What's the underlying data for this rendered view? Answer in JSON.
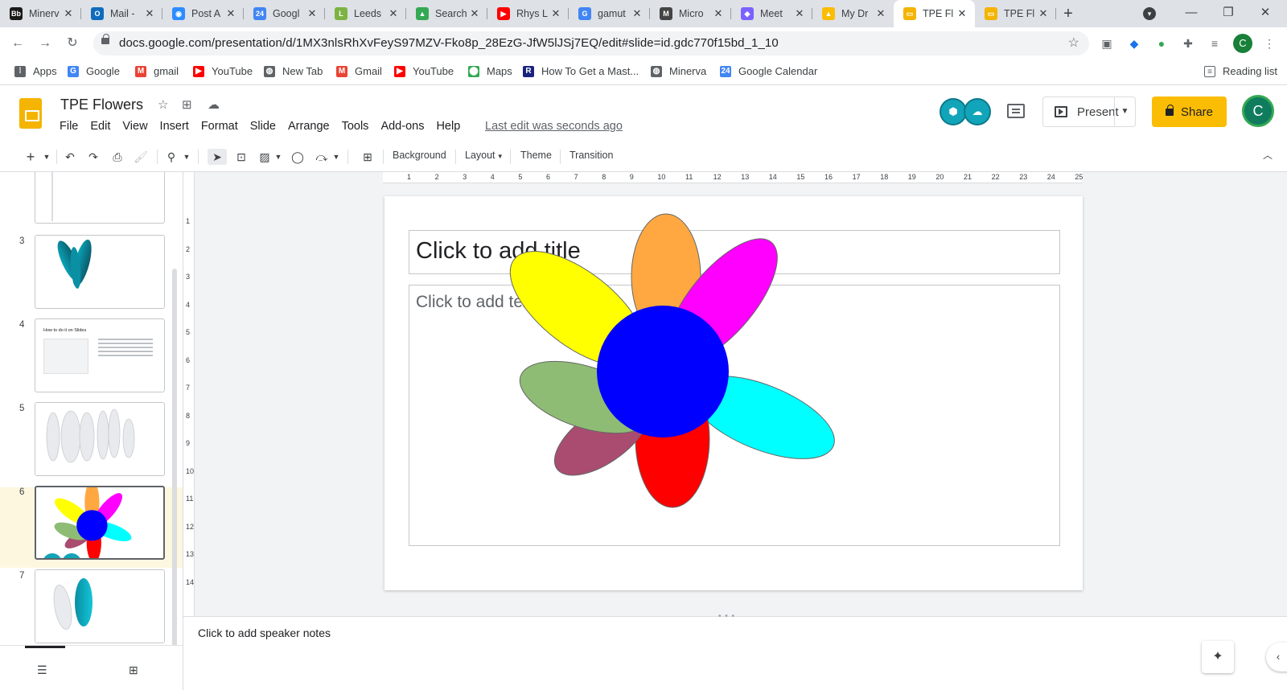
{
  "browser": {
    "tabs": [
      {
        "title": "Minerv",
        "icon": "minerva-icon",
        "color": "#1a1a1a",
        "glyph": "Bb",
        "active": false
      },
      {
        "title": "Mail -",
        "icon": "outlook-icon",
        "color": "#0f6cbd",
        "glyph": "O",
        "active": false
      },
      {
        "title": "Post A",
        "icon": "zoom-icon",
        "color": "#2d8cff",
        "glyph": "◉",
        "active": false
      },
      {
        "title": "Googl",
        "icon": "google-calendar-icon",
        "color": "#4285f4",
        "glyph": "24",
        "active": false
      },
      {
        "title": "Leeds",
        "icon": "leeds-icon",
        "color": "#7cb342",
        "glyph": "L",
        "active": false
      },
      {
        "title": "Search",
        "icon": "google-drive-icon",
        "color": "#34a853",
        "glyph": "▲",
        "active": false
      },
      {
        "title": "Rhys L",
        "icon": "youtube-icon",
        "color": "#ff0000",
        "glyph": "▶",
        "active": false
      },
      {
        "title": "gamut",
        "icon": "google-icon",
        "color": "#4285f4",
        "glyph": "G",
        "active": false
      },
      {
        "title": "Micro",
        "icon": "microsoft-icon",
        "color": "#444444",
        "glyph": "M",
        "active": false
      },
      {
        "title": "Meet",
        "icon": "meet-icon",
        "color": "#7b61ff",
        "glyph": "◆",
        "active": false
      },
      {
        "title": "My Dr",
        "icon": "google-drive-icon",
        "color": "#fbbc04",
        "glyph": "▲",
        "active": false
      },
      {
        "title": "TPE Fl",
        "icon": "google-slides-icon",
        "color": "#f4b400",
        "glyph": "▭",
        "active": true
      },
      {
        "title": "TPE Fl",
        "icon": "google-slides-icon",
        "color": "#f4b400",
        "glyph": "▭",
        "active": false
      }
    ],
    "url": "docs.google.com/presentation/d/1MX3nlsRhXvFeyS97MZV-Fko8p_28EzG-JfW5lJSj7EQ/edit#slide=id.gdc770f15bd_1_10",
    "profile_initial": "C",
    "bookmarks": [
      {
        "label": "Apps",
        "icon": "apps-grid-icon",
        "color": "#5f6368"
      },
      {
        "label": "Google",
        "icon": "google-icon",
        "color": "#4285f4"
      },
      {
        "label": "gmail",
        "icon": "gmail-icon",
        "color": "#ea4335"
      },
      {
        "label": "YouTube",
        "icon": "youtube-icon",
        "color": "#ff0000"
      },
      {
        "label": "New Tab",
        "icon": "globe-icon",
        "color": "#5f6368"
      },
      {
        "label": "Gmail",
        "icon": "gmail-icon",
        "color": "#ea4335"
      },
      {
        "label": "YouTube",
        "icon": "youtube-icon",
        "color": "#ff0000"
      },
      {
        "label": "Maps",
        "icon": "maps-pin-icon",
        "color": "#34a853"
      },
      {
        "label": "How To Get a Mast...",
        "icon": "bookmark-r-icon",
        "color": "#1a237e"
      },
      {
        "label": "Minerva",
        "icon": "globe-icon",
        "color": "#5f6368"
      },
      {
        "label": "Google Calendar",
        "icon": "google-calendar-icon",
        "color": "#4285f4"
      }
    ],
    "reading_list": "Reading list"
  },
  "app": {
    "doc_title": "TPE Flowers",
    "menu": [
      "File",
      "Edit",
      "View",
      "Insert",
      "Format",
      "Slide",
      "Arrange",
      "Tools",
      "Add-ons",
      "Help"
    ],
    "last_edit": "Last edit was seconds ago",
    "present_label": "Present",
    "share_label": "Share",
    "user_initial": "C",
    "brand_color": "#fbbc04"
  },
  "toolbar": {
    "background_label": "Background",
    "layout_label": "Layout",
    "theme_label": "Theme",
    "transition_label": "Transition"
  },
  "filmstrip": {
    "slide_numbers": [
      "3",
      "4",
      "5",
      "6",
      "7"
    ],
    "slide4_title": "How to do it on Slides",
    "current_slide": "6"
  },
  "ruler": {
    "h_marks": [
      "1",
      "2",
      "3",
      "4",
      "5",
      "6",
      "7",
      "8",
      "9",
      "10",
      "11",
      "12",
      "13",
      "14",
      "15",
      "16",
      "17",
      "18",
      "19",
      "20",
      "21",
      "22",
      "23",
      "24",
      "25"
    ],
    "v_marks": [
      "1",
      "2",
      "3",
      "4",
      "5",
      "6",
      "7",
      "8",
      "9",
      "10",
      "11",
      "12",
      "13",
      "14"
    ]
  },
  "slide": {
    "title_placeholder": "Click to add title",
    "body_placeholder": "Click to add tex",
    "petal_colors": [
      "#ffa841",
      "#ff00ff",
      "#00ffff",
      "#ff0000",
      "#a94c70",
      "#8fbc74",
      "#ffff00"
    ],
    "center_color": "#0000ff"
  },
  "notes": {
    "placeholder": "Click to add speaker notes"
  }
}
